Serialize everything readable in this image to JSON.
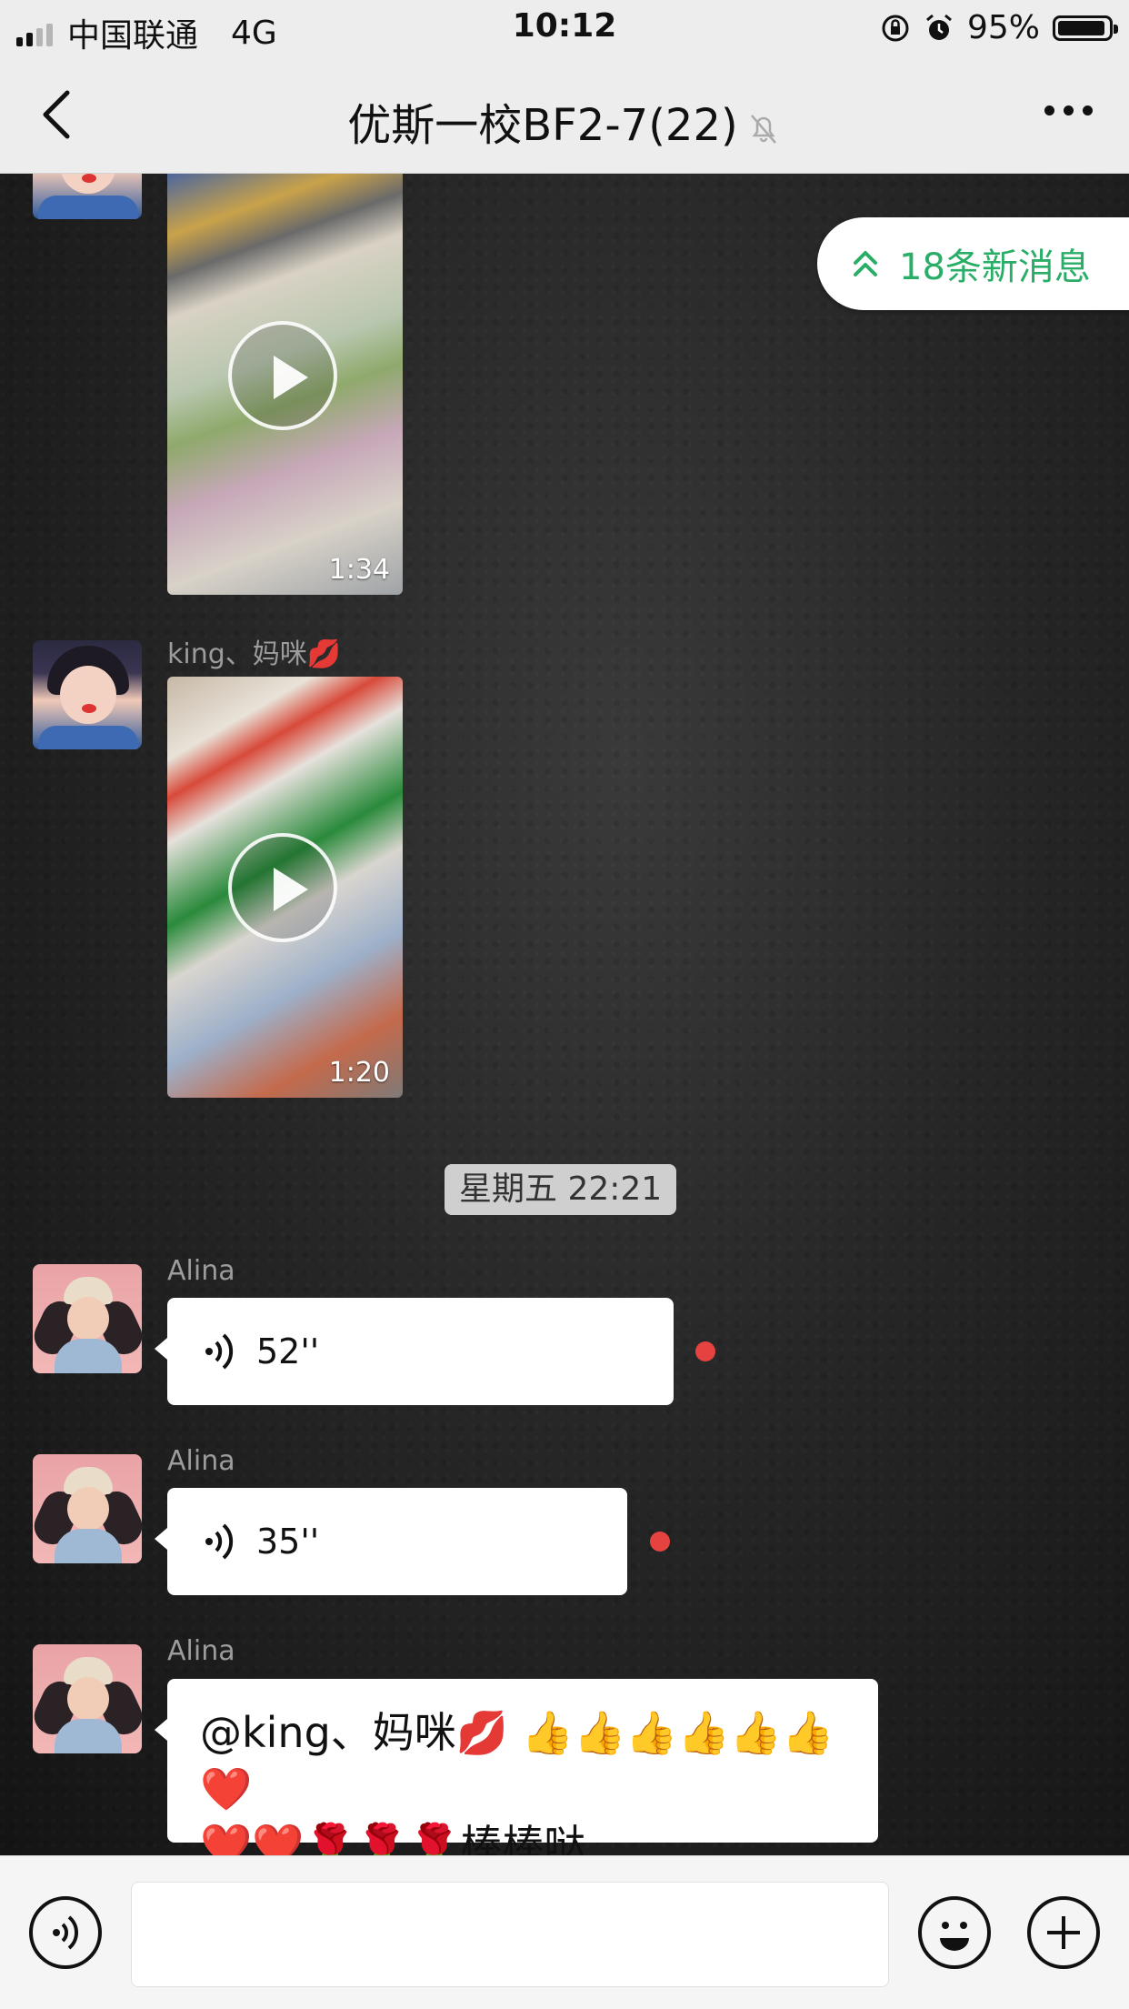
{
  "status_bar": {
    "carrier": "中国联通",
    "network": "4G",
    "time": "10:12",
    "battery_percent": "95%",
    "battery_level": 0.95
  },
  "nav": {
    "title": "优斯一校BF2-7(22)",
    "muted": true
  },
  "new_messages": {
    "label": "18条新消息"
  },
  "messages": [
    {
      "type": "video",
      "duration": "1:34",
      "avatar": "girl-avatar"
    },
    {
      "type": "video",
      "sender": "king、妈咪💋",
      "duration": "1:20",
      "avatar": "girl-avatar"
    },
    {
      "type": "time",
      "text": "星期五 22:21"
    },
    {
      "type": "voice",
      "sender": "Alina",
      "duration": "52''",
      "unread": true,
      "avatar": "kid-avatar"
    },
    {
      "type": "voice",
      "sender": "Alina",
      "duration": "35''",
      "unread": true,
      "avatar": "kid-avatar"
    },
    {
      "type": "text",
      "sender": "Alina",
      "text_line1": "@king、妈咪💋 👍👍👍👍👍👍❤️",
      "text_line2": "❤️❤️🌹🌹🌹棒棒哒",
      "avatar": "kid-avatar"
    }
  ],
  "input_bar": {
    "value": "",
    "placeholder": ""
  },
  "colors": {
    "accent_green": "#2aae67",
    "unread_dot": "#e64340",
    "bar_bg": "#ededed"
  }
}
